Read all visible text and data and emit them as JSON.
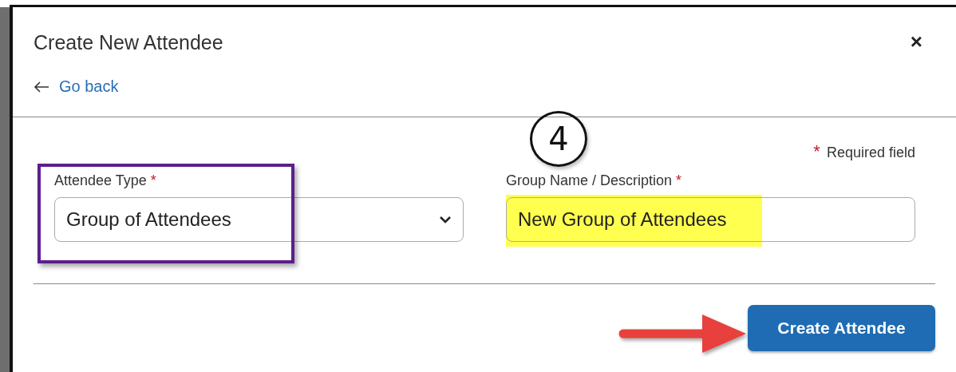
{
  "dialog": {
    "title": "Create New Attendee",
    "close": "×",
    "back_link": "Go back",
    "required_mark": "*",
    "required_note": "Required field",
    "fields": [
      {
        "kind": "select",
        "label": "Attendee Type",
        "required": true,
        "value": "Group of Attendees"
      },
      {
        "kind": "text",
        "label": "Group Name / Description",
        "required": true,
        "value": "New Group of Attendees"
      }
    ],
    "primary_button": "Create Attendee"
  },
  "annotations": [
    {
      "kind": "box"
    },
    {
      "kind": "highlight"
    },
    {
      "kind": "number",
      "text": "4"
    },
    {
      "kind": "arrow"
    }
  ]
}
